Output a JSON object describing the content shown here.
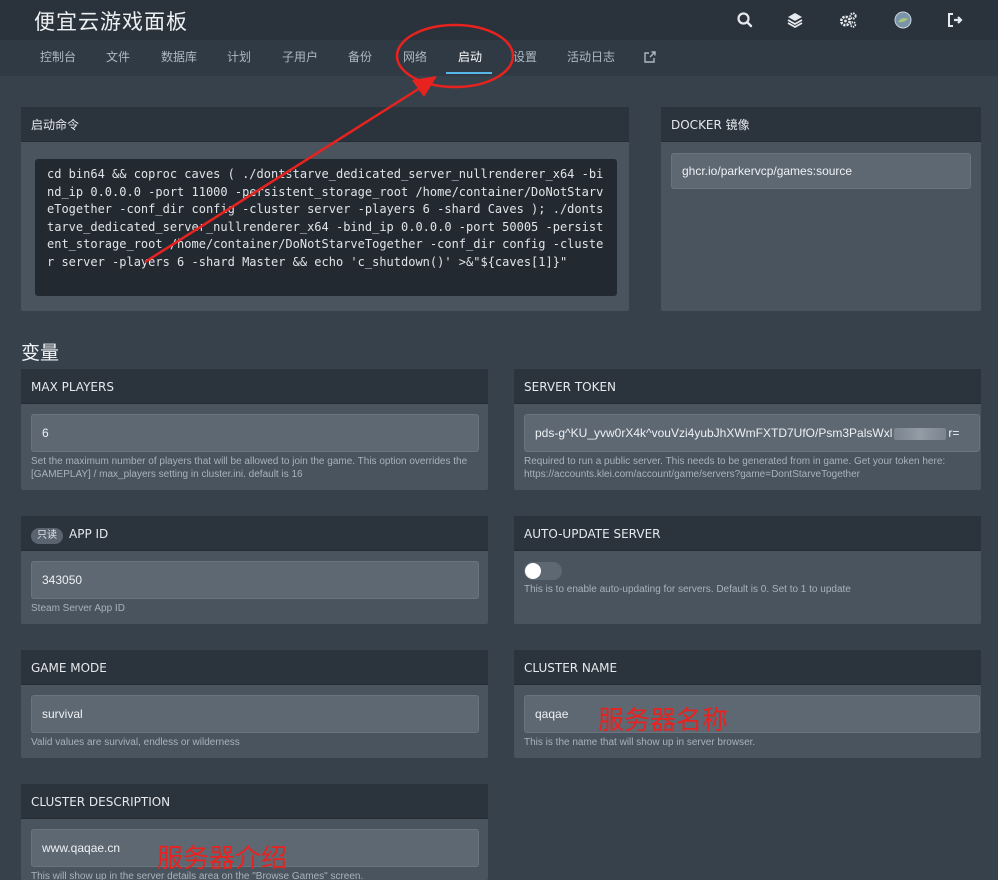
{
  "header": {
    "title": "便宜云游戏面板"
  },
  "icons": {
    "search": "search-icon",
    "layers": "layers-icon",
    "settings": "gears-icon",
    "avatar": "avatar",
    "logout": "logout-icon",
    "external": "external-link-icon"
  },
  "nav": {
    "items": [
      "控制台",
      "文件",
      "数据库",
      "计划",
      "子用户",
      "备份",
      "网络",
      "启动",
      "设置",
      "活动日志"
    ],
    "active": "启动"
  },
  "startup": {
    "title": "启动命令",
    "command": "cd bin64 && coproc caves ( ./dontstarve_dedicated_server_nullrenderer_x64 -bind_ip 0.0.0.0 -port 11000 -persistent_storage_root /home/container/DoNotStarveTogether -conf_dir config -cluster server -players 6 -shard Caves ); ./dontstarve_dedicated_server_nullrenderer_x64 -bind_ip 0.0.0.0 -port 50005 -persistent_storage_root /home/container/DoNotStarveTogether -conf_dir config -cluster server -players 6 -shard Master && echo 'c_shutdown()' >&\"${caves[1]}\""
  },
  "docker": {
    "title": "DOCKER 镜像",
    "value": "ghcr.io/parkervcp/games:source"
  },
  "variables": {
    "title": "变量",
    "max_players": {
      "label": "MAX PLAYERS",
      "value": "6",
      "hint": "Set the maximum number of players that will be allowed to join the game. This option overrides the [GAMEPLAY] / max_players setting in cluster.ini. default is 16"
    },
    "server_token": {
      "label": "SERVER TOKEN",
      "value_start": "pds-g^KU_yvw0rX4k^vouVzi4yubJhXWmFXTD7UfO/Psm3PalsWxl",
      "value_end": "r=",
      "hint": "Required to run a public server. This needs to be generated from in game. Get your token here: https://accounts.klei.com/account/game/servers?game=DontStarveTogether"
    },
    "app_id": {
      "badge": "只读",
      "label": "APP ID",
      "value": "343050",
      "hint": "Steam Server App ID"
    },
    "auto_update": {
      "label": "AUTO-UPDATE SERVER",
      "enabled": false,
      "hint": "This is to enable auto-updating for servers. Default is 0. Set to 1 to update"
    },
    "game_mode": {
      "label": "GAME MODE",
      "value": "survival",
      "hint": "Valid values are survival, endless or wilderness"
    },
    "cluster_name": {
      "label": "CLUSTER NAME",
      "value": "qaqae",
      "hint": "This is the name that will show up in server browser.",
      "annotation": "服务器名称"
    },
    "cluster_description": {
      "label": "CLUSTER DESCRIPTION",
      "value": "www.qaqae.cn",
      "hint": "This will show up in the server details area on the \"Browse Games\" screen.",
      "annotation": "服务器介绍"
    }
  },
  "colors": {
    "background": "#37414b",
    "panel": "#4a545e",
    "panel_header": "#2b333c",
    "accent": "#58b6e8",
    "annotation": "#e8231f"
  }
}
